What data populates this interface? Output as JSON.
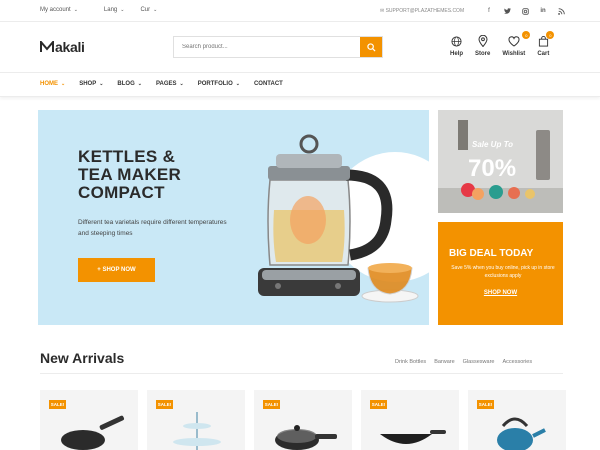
{
  "topbar": {
    "my_account": "My account",
    "lang": "Lang",
    "cur": "Cur",
    "support": "SUPPORT@PLAZATHEMES.COM",
    "social": [
      "facebook-icon",
      "twitter-icon",
      "instagram-icon",
      "linkedin-icon",
      "rss-icon"
    ]
  },
  "header": {
    "logo": "akali",
    "search_placeholder": "Search product...",
    "help": "Help",
    "store": "Store",
    "wishlist": "Wishlist",
    "wishlist_count": "0",
    "cart": "Cart",
    "cart_count": "0"
  },
  "nav": {
    "items": [
      "HOME",
      "SHOP",
      "BLOG",
      "PAGES",
      "PORTFOLIO",
      "CONTACT"
    ]
  },
  "hero": {
    "line1": "KETTLES &",
    "line2": "TEA MAKER",
    "line3": "COMPACT",
    "desc": "Different tea varietals require different temperatures and steeping times",
    "button": "+ SHOP NOW"
  },
  "sale_banner": {
    "label": "Sale Up To",
    "percent": "70%"
  },
  "deal_banner": {
    "title": "BIG DEAL TODAY",
    "desc": "Save 5% when you buy online, pick up in store exclusions apply",
    "button": "SHOP NOW"
  },
  "new_arrivals": {
    "title": "New Arrivals",
    "tabs": [
      "Drink Bottles",
      "Barware",
      "Glassesware",
      "Accessories"
    ],
    "sale_badge": "SALE!"
  },
  "colors": {
    "accent": "#f39200",
    "hero_bg": "#c9e8f6"
  }
}
